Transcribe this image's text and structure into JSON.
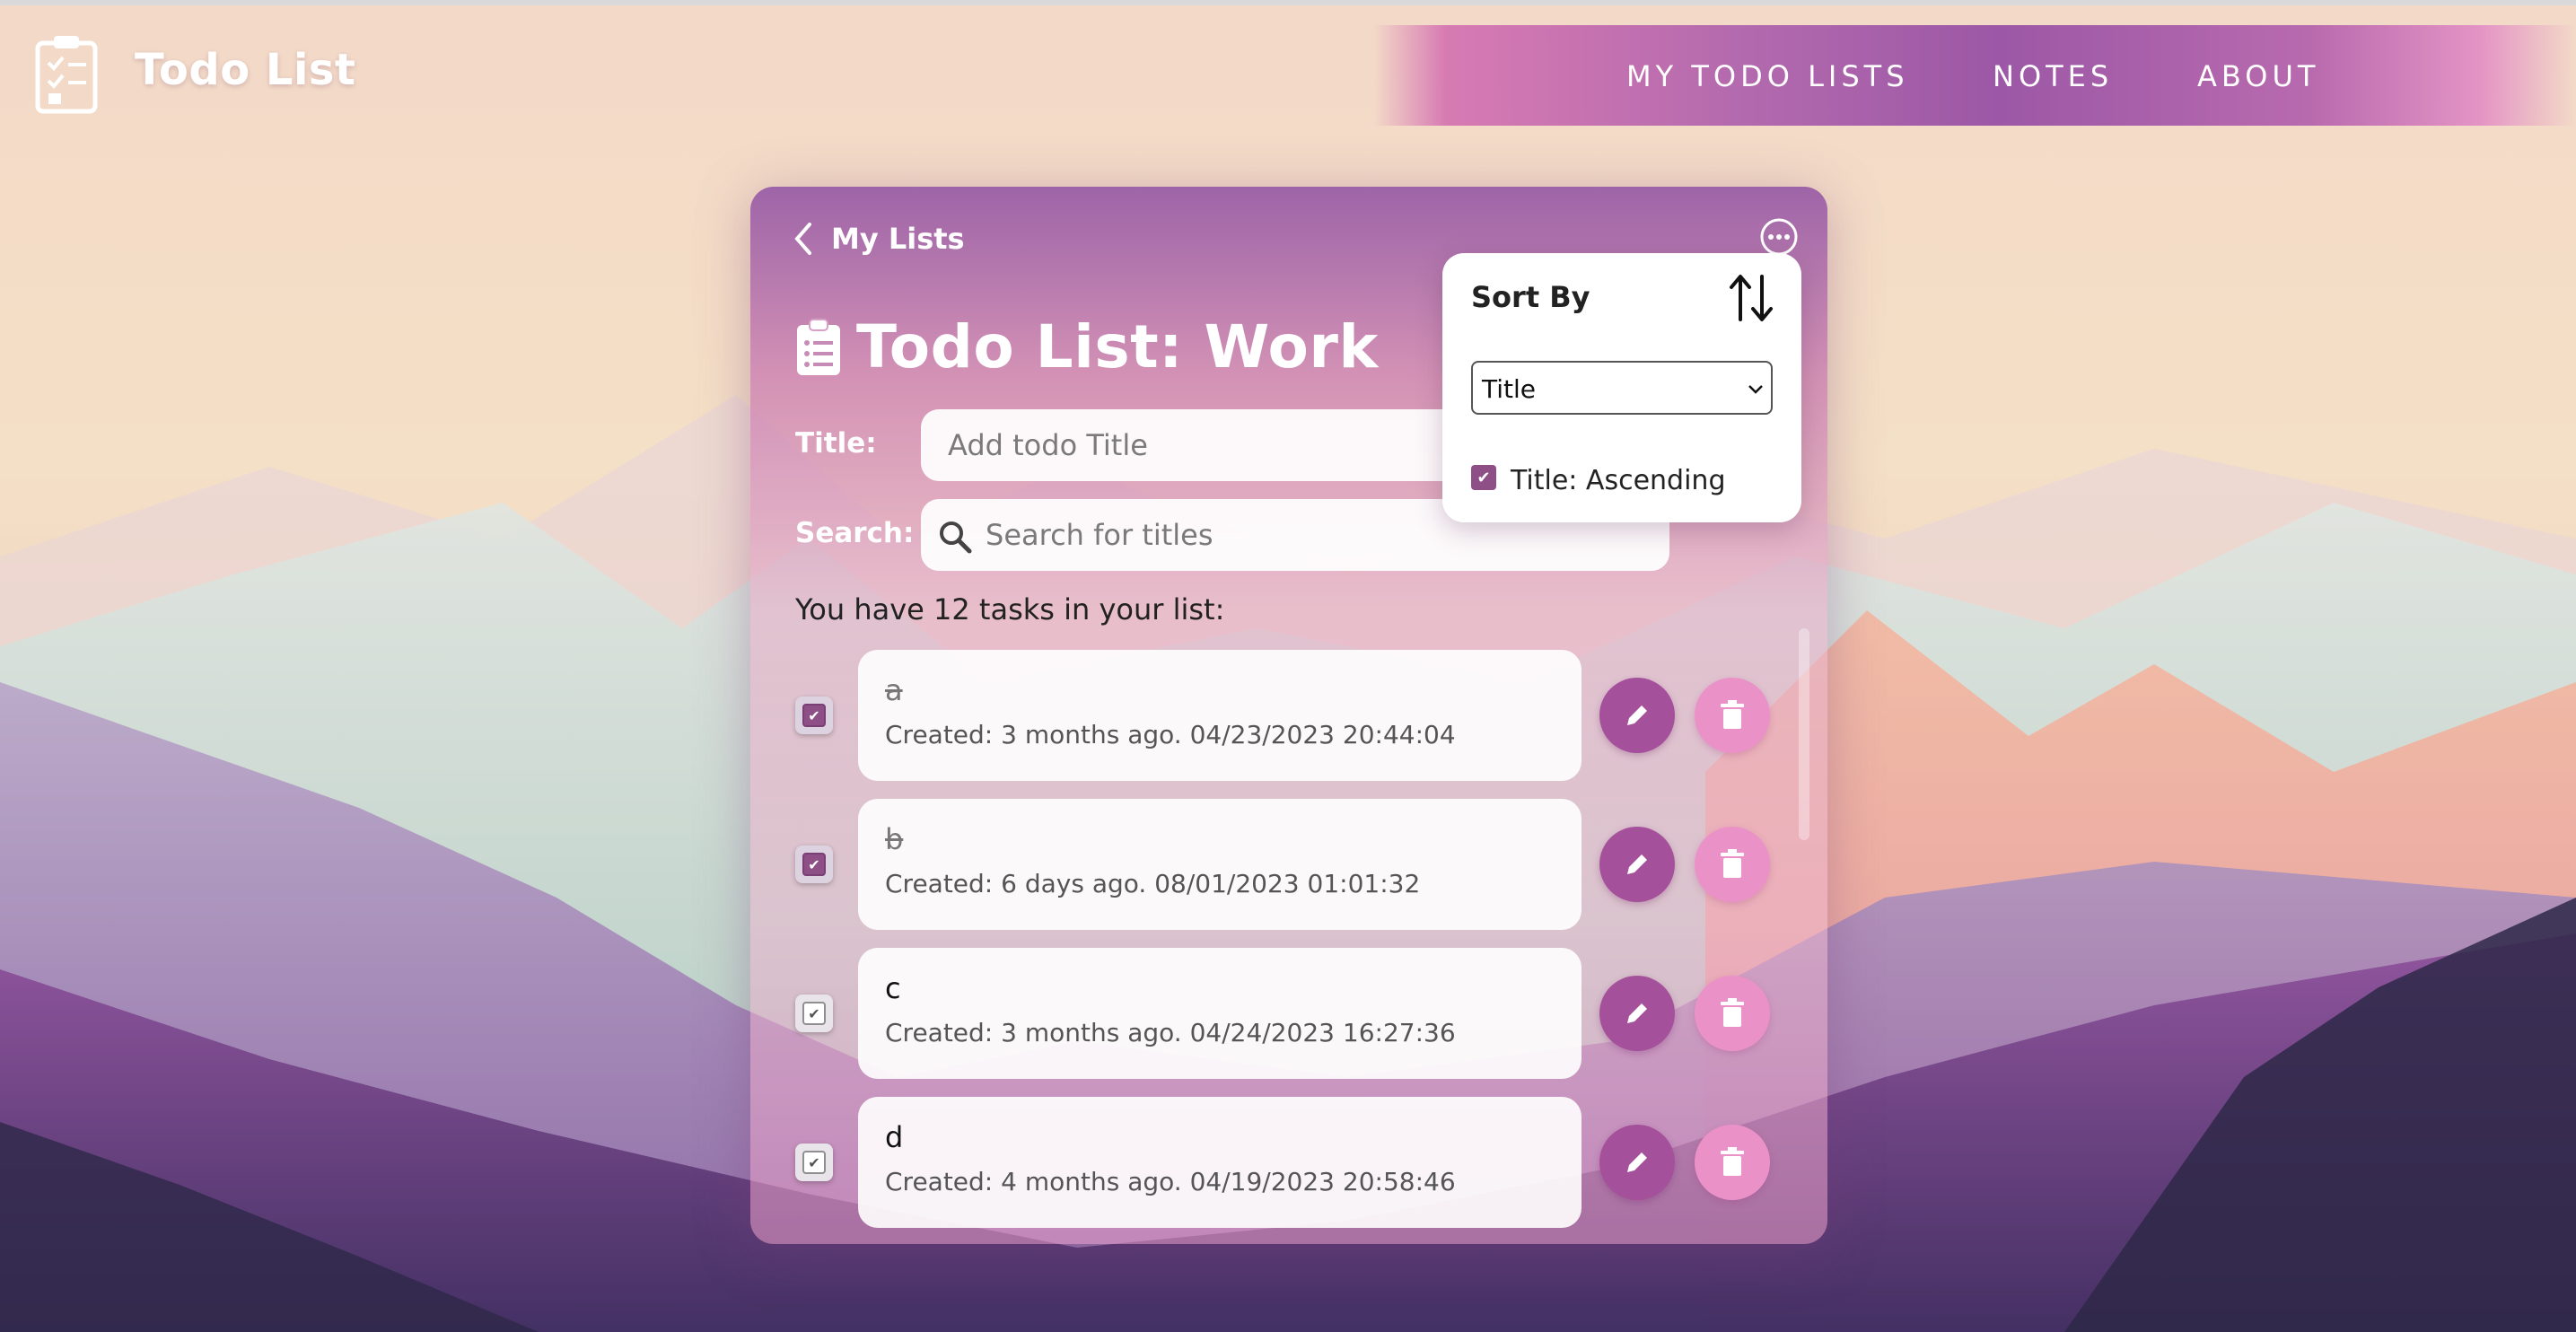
{
  "app": {
    "title": "Todo List"
  },
  "nav": {
    "items": [
      {
        "label": "MY TODO LISTS"
      },
      {
        "label": "NOTES"
      },
      {
        "label": "ABOUT"
      }
    ]
  },
  "card": {
    "back_label": "My Lists",
    "heading": "Todo List: Work",
    "title_label": "Title:",
    "title_placeholder": "Add todo Title",
    "search_label": "Search:",
    "search_placeholder": "Search for titles",
    "count_text": "You have 12 tasks in your list:"
  },
  "todos": [
    {
      "title": "a",
      "created": "Created: 3 months ago. 04/23/2023 20:44:04",
      "done": true
    },
    {
      "title": "b",
      "created": "Created: 6 days ago. 08/01/2023 01:01:32",
      "done": true
    },
    {
      "title": "c",
      "created": "Created: 3 months ago. 04/24/2023 16:27:36",
      "done": false
    },
    {
      "title": "d",
      "created": "Created: 4 months ago. 04/19/2023 20:58:46",
      "done": false
    }
  ],
  "sort": {
    "title": "Sort By",
    "selected": "Title",
    "options": [
      "Title"
    ],
    "ascending_label": "Title: Ascending",
    "ascending_checked": true
  },
  "colors": {
    "accent_purple": "#a4509b",
    "accent_pink": "#ea92c8",
    "checkbox_checked": "#8d4f86"
  }
}
